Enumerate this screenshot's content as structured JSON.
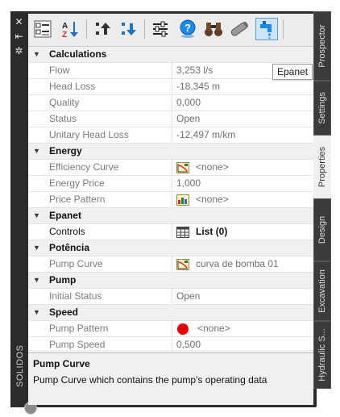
{
  "window": {
    "vertical_title": "SOLIDOS"
  },
  "tooltip": "Epanet",
  "toolbar": {
    "buttons": [
      {
        "name": "categorized-view-button",
        "icon": "categorized-list-icon"
      },
      {
        "name": "alphabetical-sort-button",
        "icon": "sort-az-icon"
      },
      {
        "name": "move-up-button",
        "icon": "move-up-icon"
      },
      {
        "name": "move-down-button",
        "icon": "move-down-icon"
      },
      {
        "name": "filter-settings-button",
        "icon": "sliders-icon"
      },
      {
        "name": "help-button",
        "icon": "help-icon"
      },
      {
        "name": "find-button",
        "icon": "binoculars-icon"
      },
      {
        "name": "pipe-button",
        "icon": "pipe-icon"
      },
      {
        "name": "epanet-button",
        "icon": "faucet-icon"
      }
    ]
  },
  "categories": [
    {
      "label": "Calculations",
      "properties": [
        {
          "name": "Flow",
          "value": "3,253 l/s"
        },
        {
          "name": "Head Loss",
          "value": "-18,345 m"
        },
        {
          "name": "Quality",
          "value": "0,000"
        },
        {
          "name": "Status",
          "value": "Open"
        },
        {
          "name": "Unitary Head Loss",
          "value": "-12,497 m/km"
        }
      ]
    },
    {
      "label": "Energy",
      "properties": [
        {
          "name": "Efficiency Curve",
          "value": "<none>",
          "icon": "curve-icon"
        },
        {
          "name": "Energy Price",
          "value": "1,000"
        },
        {
          "name": "Price Pattern",
          "value": "<none>",
          "icon": "pattern-icon"
        }
      ]
    },
    {
      "label": "Epanet",
      "properties": [
        {
          "name": "Controls",
          "value": "List (0)",
          "icon": "table-icon"
        }
      ]
    },
    {
      "label": "Potência",
      "properties": [
        {
          "name": "Pump Curve",
          "value": "curva de bomba 01",
          "icon": "curve-icon"
        }
      ]
    },
    {
      "label": "Pump",
      "properties": [
        {
          "name": "Initial Status",
          "value": "Open"
        }
      ]
    },
    {
      "label": "Speed",
      "properties": [
        {
          "name": "Pump Pattern",
          "value": "<none>",
          "icon": "red-dot-icon"
        },
        {
          "name": "Pump Speed",
          "value": "0,500"
        }
      ]
    }
  ],
  "description": {
    "title": "Pump Curve",
    "text": "Pump Curve which contains the pump's operating data"
  },
  "tabs": [
    {
      "label": "Prospector"
    },
    {
      "label": "Settings"
    },
    {
      "label": "Properties"
    },
    {
      "label": "Design"
    },
    {
      "label": "Excavation"
    },
    {
      "label": "Hydraulic S..."
    }
  ],
  "colors": {
    "accent": "#1e88e5",
    "panel_bg": "#f0f0f0",
    "frame": "#2b2b2b",
    "red_dot": "#e00000"
  }
}
